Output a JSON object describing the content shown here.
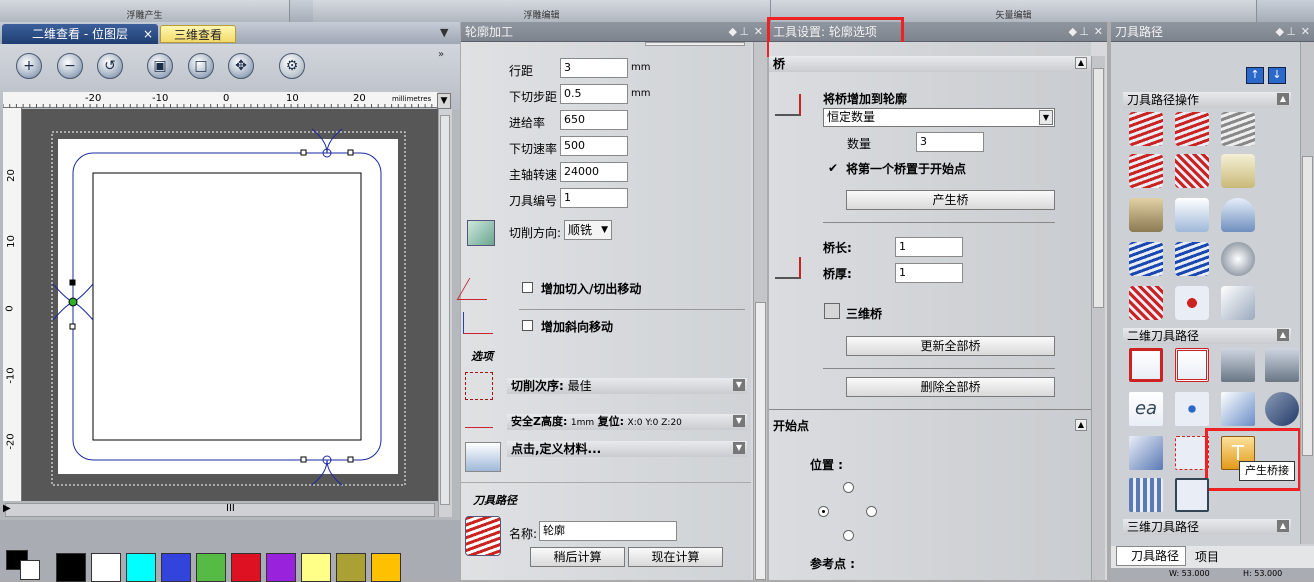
{
  "ribbon": {
    "groups": [
      "浮雕产生",
      "浮雕编辑",
      "矢量编辑"
    ]
  },
  "view": {
    "tabs": [
      "二维查看 - 位图层",
      "三维查看"
    ],
    "ruler_unit": "millimetres",
    "x_ticks": [
      "-20",
      "-10",
      "0",
      "10",
      "20"
    ],
    "y_ticks": [
      "20",
      "10",
      "0",
      "-10",
      "-20"
    ],
    "hscroll_label": "III",
    "swatches": [
      "#000000",
      "#ffffff",
      "#00ffff",
      "#3344dd",
      "#55bb44",
      "#dd1122",
      "#9922dd",
      "#ffff88",
      "#aaa033",
      "#ffc000"
    ]
  },
  "profile": {
    "title": "轮廓加工",
    "params": [
      {
        "label": "行距",
        "value": "3",
        "unit": "mm"
      },
      {
        "label": "下切步距",
        "value": "0.5",
        "unit": "mm"
      },
      {
        "label": "进给率",
        "value": "650",
        "unit": ""
      },
      {
        "label": "下切速率",
        "value": "500",
        "unit": ""
      },
      {
        "label": "主轴转速",
        "value": "24000",
        "unit": ""
      },
      {
        "label": "刀具编号",
        "value": "1",
        "unit": ""
      }
    ],
    "cut_direction_label": "切削方向:",
    "cut_direction_value": "顺铣",
    "lead_in_label": "增加切入/切出移动",
    "ramp_label": "增加斜向移动",
    "options_header": "选项",
    "order_label": "切削次序:",
    "order_value": "最佳",
    "safe_label": "安全Z高度:",
    "safe_value": "1mm",
    "home_label": "复位:",
    "home_value": "X:0 Y:0 Z:20",
    "material_label": "点击,定义材料...",
    "toolpath_header": "刀具路径",
    "name_label": "名称:",
    "name_value": "轮廓",
    "calc_later": "稍后计算",
    "calc_now": "现在计算"
  },
  "tool_settings": {
    "title": "工具设置: 轮廓选项",
    "bridge_section": "桥",
    "add_bridges_label": "将桥增加到轮廓",
    "mode_value": "恒定数量",
    "count_label": "数量",
    "count_value": "3",
    "first_at_start_label": "将第一个桥置于开始点",
    "generate_button": "产生桥",
    "length_label": "桥长:",
    "length_value": "1",
    "thickness_label": "桥厚:",
    "thickness_value": "1",
    "threed_label": "三维桥",
    "update_all_button": "更新全部桥",
    "delete_all_button": "删除全部桥",
    "start_section": "开始点",
    "position_label": "位置 :",
    "reference_label": "参考点 :"
  },
  "toolpaths": {
    "title": "刀具路径",
    "ops_header": "刀具路径操作",
    "two_d_header": "二维刀具路径",
    "three_d_header": "三维刀具路径",
    "tooltip": "产生桥接",
    "bottom_tabs": [
      "刀具路径",
      "项目"
    ],
    "status": [
      "W: 53.000",
      "H: 53.000"
    ]
  },
  "highlight_color": "#ee2222"
}
